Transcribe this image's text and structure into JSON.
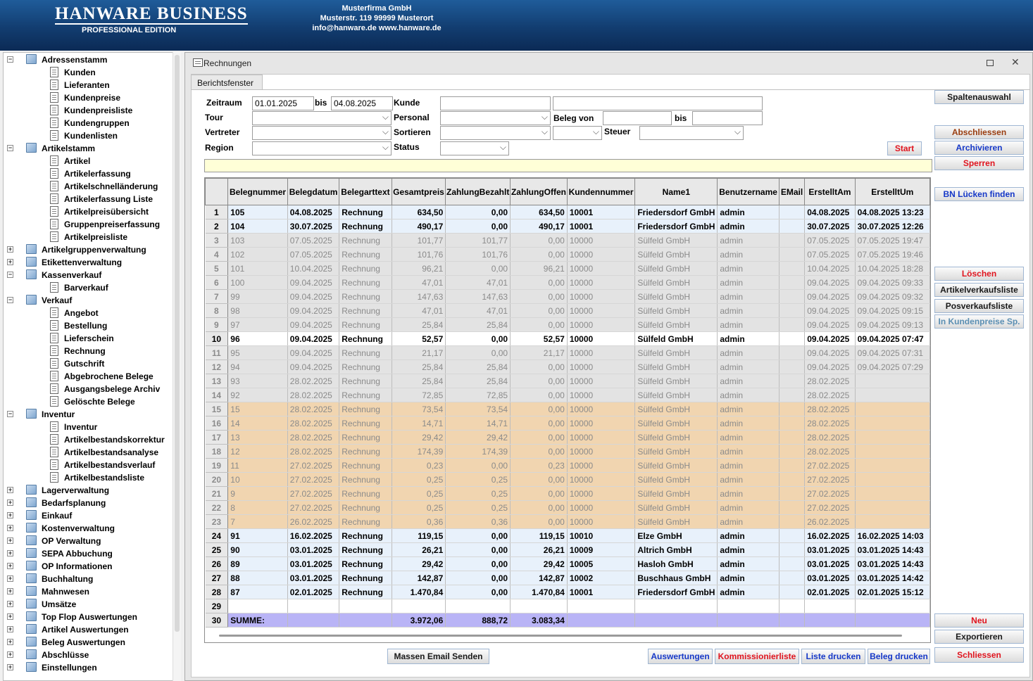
{
  "header": {
    "logo_title": "HANWARE BUSINESS",
    "logo_sub": "PROFESSIONAL EDITION",
    "company_name": "Musterfirma GmbH",
    "company_address": "Musterstr. 119 99999 Musterort",
    "company_contact": "info@hanware.de  www.hanware.de"
  },
  "nav": [
    {
      "label": "Adressenstamm",
      "level": 0,
      "expander": "-"
    },
    {
      "label": "Kunden",
      "level": 1
    },
    {
      "label": "Lieferanten",
      "level": 1
    },
    {
      "label": "Kundenpreise",
      "level": 1
    },
    {
      "label": "Kundenpreisliste",
      "level": 1
    },
    {
      "label": "Kundengruppen",
      "level": 1
    },
    {
      "label": "Kundenlisten",
      "level": 1
    },
    {
      "label": "Artikelstamm",
      "level": 0,
      "expander": "-"
    },
    {
      "label": "Artikel",
      "level": 1
    },
    {
      "label": "Artikelerfassung",
      "level": 1
    },
    {
      "label": "Artikelschnelländerung",
      "level": 1
    },
    {
      "label": "Artikelerfassung Liste",
      "level": 1
    },
    {
      "label": "Artikelpreisübersicht",
      "level": 1
    },
    {
      "label": "Gruppenpreiserfassung",
      "level": 1
    },
    {
      "label": "Artikelpreisliste",
      "level": 1
    },
    {
      "label": "Artikelgruppenverwaltung",
      "level": 0,
      "expander": "+"
    },
    {
      "label": "Etikettenverwaltung",
      "level": 0,
      "expander": "+"
    },
    {
      "label": "Kassenverkauf",
      "level": 0,
      "expander": "-"
    },
    {
      "label": "Barverkauf",
      "level": 1
    },
    {
      "label": "Verkauf",
      "level": 0,
      "expander": "-"
    },
    {
      "label": "Angebot",
      "level": 1
    },
    {
      "label": "Bestellung",
      "level": 1
    },
    {
      "label": "Lieferschein",
      "level": 1
    },
    {
      "label": "Rechnung",
      "level": 1
    },
    {
      "label": "Gutschrift",
      "level": 1
    },
    {
      "label": "Abgebrochene Belege",
      "level": 1
    },
    {
      "label": "Ausgangsbelege Archiv",
      "level": 1
    },
    {
      "label": "Gelöschte Belege",
      "level": 1
    },
    {
      "label": "Inventur",
      "level": 0,
      "expander": "-"
    },
    {
      "label": "Inventur",
      "level": 1
    },
    {
      "label": "Artikelbestandskorrektur",
      "level": 1
    },
    {
      "label": "Artikelbestandsanalyse",
      "level": 1
    },
    {
      "label": "Artikelbestandsverlauf",
      "level": 1
    },
    {
      "label": "Artikelbestandsliste",
      "level": 1
    },
    {
      "label": "Lagerverwaltung",
      "level": 0,
      "expander": "+"
    },
    {
      "label": "Bedarfsplanung",
      "level": 0,
      "expander": "+"
    },
    {
      "label": "Einkauf",
      "level": 0,
      "expander": "+"
    },
    {
      "label": "Kostenverwaltung",
      "level": 0,
      "expander": "+"
    },
    {
      "label": "OP Verwaltung",
      "level": 0,
      "expander": "+"
    },
    {
      "label": "SEPA Abbuchung",
      "level": 0,
      "expander": "+"
    },
    {
      "label": "OP Informationen",
      "level": 0,
      "expander": "+"
    },
    {
      "label": "Buchhaltung",
      "level": 0,
      "expander": "+"
    },
    {
      "label": "Mahnwesen",
      "level": 0,
      "expander": "+"
    },
    {
      "label": "Umsätze",
      "level": 0,
      "expander": "+"
    },
    {
      "label": "Top Flop Auswertungen",
      "level": 0,
      "expander": "+"
    },
    {
      "label": "Artikel Auswertungen",
      "level": 0,
      "expander": "+"
    },
    {
      "label": "Beleg Auswertungen",
      "level": 0,
      "expander": "+"
    },
    {
      "label": "Abschlüsse",
      "level": 0,
      "expander": "+"
    },
    {
      "label": "Einstellungen",
      "level": 0,
      "expander": "+"
    }
  ],
  "window": {
    "title": "Rechnungen",
    "tab": "Berichtsfenster"
  },
  "filters": {
    "zeitraum_label": "Zeitraum",
    "date_from": "01.01.2025",
    "bis_label": "bis",
    "date_to": "04.08.2025",
    "kunde_label": "Kunde",
    "tour_label": "Tour",
    "personal_label": "Personal",
    "beleg_von_label": "Beleg von",
    "bis2_label": "bis",
    "vertreter_label": "Vertreter",
    "sortieren_label": "Sortieren",
    "steuer_label": "Steuer",
    "region_label": "Region",
    "status_label": "Status",
    "start_label": "Start"
  },
  "buttons": {
    "spaltenauswahl": "Spaltenauswahl",
    "abschliessen": "Abschliessen",
    "archivieren": "Archivieren",
    "sperren": "Sperren",
    "bn_luecken": "BN Lücken finden",
    "loeschen": "Löschen",
    "artikelverkaufsliste": "Artikelverkaufsliste",
    "posverkaufsliste": "Posverkaufsliste",
    "in_kundenpreise": "In Kundenpreise Sp.",
    "neu": "Neu",
    "exportieren": "Exportieren",
    "schliessen": "Schliessen",
    "massen_email": "Massen Email Senden",
    "auswertungen": "Auswertungen",
    "kommissionierliste": "Kommissionierliste",
    "liste_drucken": "Liste drucken",
    "beleg_drucken": "Beleg drucken"
  },
  "colors": {
    "red_text": "#e0141e",
    "blue_text": "#1638c8",
    "brown_text": "#9a3d10",
    "teal_text": "#5b8fb3",
    "sum_row": "#b9b4f6",
    "orange_row": "#f1d5b0",
    "grey_row": "#e3e3e3",
    "blue_row": "#e8f1fb"
  },
  "table": {
    "columns": [
      "Belegnummer",
      "Belegdatum",
      "Belegarttext",
      "Gesamtpreis",
      "ZahlungBezahlt",
      "ZahlungOffen",
      "Kundennummer",
      "Name1",
      "Benutzername",
      "EMail",
      "ErstelltAm",
      "ErstelltUm"
    ],
    "rows": [
      {
        "n": "1",
        "t": "blue",
        "c": [
          "105",
          "04.08.2025",
          "Rechnung",
          "634,50",
          "0,00",
          "634,50",
          "10001",
          "Friedersdorf GmbH",
          "admin",
          "",
          "04.08.2025",
          "04.08.2025 13:23"
        ]
      },
      {
        "n": "2",
        "t": "blue",
        "c": [
          "104",
          "30.07.2025",
          "Rechnung",
          "490,17",
          "0,00",
          "490,17",
          "10001",
          "Friedersdorf GmbH",
          "admin",
          "",
          "30.07.2025",
          "30.07.2025 12:26"
        ]
      },
      {
        "n": "3",
        "t": "grey",
        "c": [
          "103",
          "07.05.2025",
          "Rechnung",
          "101,77",
          "101,77",
          "0,00",
          "10000",
          "Sülfeld GmbH",
          "admin",
          "",
          "07.05.2025",
          "07.05.2025 19:47"
        ]
      },
      {
        "n": "4",
        "t": "grey",
        "c": [
          "102",
          "07.05.2025",
          "Rechnung",
          "101,76",
          "101,76",
          "0,00",
          "10000",
          "Sülfeld GmbH",
          "admin",
          "",
          "07.05.2025",
          "07.05.2025 19:46"
        ]
      },
      {
        "n": "5",
        "t": "grey",
        "c": [
          "101",
          "10.04.2025",
          "Rechnung",
          "96,21",
          "0,00",
          "96,21",
          "10000",
          "Sülfeld GmbH",
          "admin",
          "",
          "10.04.2025",
          "10.04.2025 18:28"
        ]
      },
      {
        "n": "6",
        "t": "grey",
        "c": [
          "100",
          "09.04.2025",
          "Rechnung",
          "47,01",
          "47,01",
          "0,00",
          "10000",
          "Sülfeld GmbH",
          "admin",
          "",
          "09.04.2025",
          "09.04.2025 09:33"
        ]
      },
      {
        "n": "7",
        "t": "grey",
        "c": [
          "99",
          "09.04.2025",
          "Rechnung",
          "147,63",
          "147,63",
          "0,00",
          "10000",
          "Sülfeld GmbH",
          "admin",
          "",
          "09.04.2025",
          "09.04.2025 09:32"
        ]
      },
      {
        "n": "8",
        "t": "grey",
        "c": [
          "98",
          "09.04.2025",
          "Rechnung",
          "47,01",
          "47,01",
          "0,00",
          "10000",
          "Sülfeld GmbH",
          "admin",
          "",
          "09.04.2025",
          "09.04.2025 09:15"
        ]
      },
      {
        "n": "9",
        "t": "grey",
        "c": [
          "97",
          "09.04.2025",
          "Rechnung",
          "25,84",
          "25,84",
          "0,00",
          "10000",
          "Sülfeld GmbH",
          "admin",
          "",
          "09.04.2025",
          "09.04.2025 09:13"
        ]
      },
      {
        "n": "10",
        "t": "white",
        "c": [
          "96",
          "09.04.2025",
          "Rechnung",
          "52,57",
          "0,00",
          "52,57",
          "10000",
          "Sülfeld GmbH",
          "admin",
          "",
          "09.04.2025",
          "09.04.2025 07:47"
        ]
      },
      {
        "n": "11",
        "t": "grey",
        "c": [
          "95",
          "09.04.2025",
          "Rechnung",
          "21,17",
          "0,00",
          "21,17",
          "10000",
          "Sülfeld GmbH",
          "admin",
          "",
          "09.04.2025",
          "09.04.2025 07:31"
        ]
      },
      {
        "n": "12",
        "t": "grey",
        "c": [
          "94",
          "09.04.2025",
          "Rechnung",
          "25,84",
          "25,84",
          "0,00",
          "10000",
          "Sülfeld GmbH",
          "admin",
          "",
          "09.04.2025",
          "09.04.2025 07:29"
        ]
      },
      {
        "n": "13",
        "t": "grey",
        "c": [
          "93",
          "28.02.2025",
          "Rechnung",
          "25,84",
          "25,84",
          "0,00",
          "10000",
          "Sülfeld GmbH",
          "admin",
          "",
          "28.02.2025",
          ""
        ]
      },
      {
        "n": "14",
        "t": "grey",
        "c": [
          "92",
          "28.02.2025",
          "Rechnung",
          "72,85",
          "72,85",
          "0,00",
          "10000",
          "Sülfeld GmbH",
          "admin",
          "",
          "28.02.2025",
          ""
        ]
      },
      {
        "n": "15",
        "t": "orange",
        "c": [
          "15",
          "28.02.2025",
          "Rechnung",
          "73,54",
          "73,54",
          "0,00",
          "10000",
          "Sülfeld GmbH",
          "admin",
          "",
          "28.02.2025",
          ""
        ]
      },
      {
        "n": "16",
        "t": "orange",
        "c": [
          "14",
          "28.02.2025",
          "Rechnung",
          "14,71",
          "14,71",
          "0,00",
          "10000",
          "Sülfeld GmbH",
          "admin",
          "",
          "28.02.2025",
          ""
        ]
      },
      {
        "n": "17",
        "t": "orange",
        "c": [
          "13",
          "28.02.2025",
          "Rechnung",
          "29,42",
          "29,42",
          "0,00",
          "10000",
          "Sülfeld GmbH",
          "admin",
          "",
          "28.02.2025",
          ""
        ]
      },
      {
        "n": "18",
        "t": "orange",
        "c": [
          "12",
          "28.02.2025",
          "Rechnung",
          "174,39",
          "174,39",
          "0,00",
          "10000",
          "Sülfeld GmbH",
          "admin",
          "",
          "28.02.2025",
          ""
        ]
      },
      {
        "n": "19",
        "t": "orange",
        "c": [
          "11",
          "27.02.2025",
          "Rechnung",
          "0,23",
          "0,00",
          "0,23",
          "10000",
          "Sülfeld GmbH",
          "admin",
          "",
          "27.02.2025",
          ""
        ]
      },
      {
        "n": "20",
        "t": "orange",
        "c": [
          "10",
          "27.02.2025",
          "Rechnung",
          "0,25",
          "0,25",
          "0,00",
          "10000",
          "Sülfeld GmbH",
          "admin",
          "",
          "27.02.2025",
          ""
        ]
      },
      {
        "n": "21",
        "t": "orange",
        "c": [
          "9",
          "27.02.2025",
          "Rechnung",
          "0,25",
          "0,25",
          "0,00",
          "10000",
          "Sülfeld GmbH",
          "admin",
          "",
          "27.02.2025",
          ""
        ]
      },
      {
        "n": "22",
        "t": "orange",
        "c": [
          "8",
          "27.02.2025",
          "Rechnung",
          "0,25",
          "0,25",
          "0,00",
          "10000",
          "Sülfeld GmbH",
          "admin",
          "",
          "27.02.2025",
          ""
        ]
      },
      {
        "n": "23",
        "t": "orange",
        "c": [
          "7",
          "26.02.2025",
          "Rechnung",
          "0,36",
          "0,36",
          "0,00",
          "10000",
          "Sülfeld GmbH",
          "admin",
          "",
          "26.02.2025",
          ""
        ]
      },
      {
        "n": "24",
        "t": "blue",
        "c": [
          "91",
          "16.02.2025",
          "Rechnung",
          "119,15",
          "0,00",
          "119,15",
          "10010",
          "Elze GmbH",
          "admin",
          "",
          "16.02.2025",
          "16.02.2025 14:03"
        ]
      },
      {
        "n": "25",
        "t": "blue",
        "c": [
          "90",
          "03.01.2025",
          "Rechnung",
          "26,21",
          "0,00",
          "26,21",
          "10009",
          "Altrich GmbH",
          "admin",
          "",
          "03.01.2025",
          "03.01.2025 14:43"
        ]
      },
      {
        "n": "26",
        "t": "blue",
        "c": [
          "89",
          "03.01.2025",
          "Rechnung",
          "29,42",
          "0,00",
          "29,42",
          "10005",
          "Hasloh GmbH",
          "admin",
          "",
          "03.01.2025",
          "03.01.2025 14:43"
        ]
      },
      {
        "n": "27",
        "t": "blue",
        "c": [
          "88",
          "03.01.2025",
          "Rechnung",
          "142,87",
          "0,00",
          "142,87",
          "10002",
          "Buschhaus GmbH",
          "admin",
          "",
          "03.01.2025",
          "03.01.2025 14:42"
        ]
      },
      {
        "n": "28",
        "t": "blue",
        "c": [
          "87",
          "02.01.2025",
          "Rechnung",
          "1.470,84",
          "0,00",
          "1.470,84",
          "10001",
          "Friedersdorf GmbH",
          "admin",
          "",
          "02.01.2025",
          "02.01.2025 15:12"
        ]
      },
      {
        "n": "29",
        "t": "empty",
        "c": [
          "",
          "",
          "",
          "",
          "",
          "",
          "",
          "",
          "",
          "",
          "",
          ""
        ]
      },
      {
        "n": "30",
        "t": "sum",
        "c": [
          "SUMME:",
          "",
          "",
          "3.972,06",
          "888,72",
          "3.083,34",
          "",
          "",
          "",
          "",
          "",
          ""
        ]
      }
    ]
  }
}
